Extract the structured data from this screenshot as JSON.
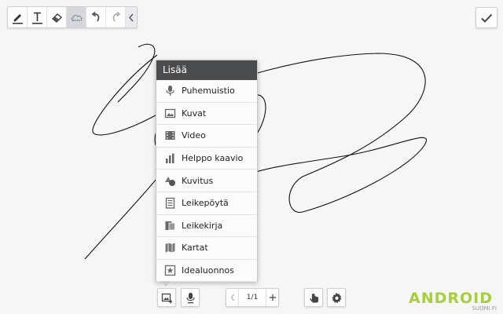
{
  "toolbar": {
    "tools": [
      {
        "icon": "pen-icon",
        "active": false
      },
      {
        "icon": "text-icon",
        "active": false
      },
      {
        "icon": "eraser-icon",
        "active": false
      },
      {
        "icon": "lasso-cloud-icon",
        "active": true
      },
      {
        "icon": "undo-icon",
        "active": false
      },
      {
        "icon": "redo-icon",
        "active": false
      },
      {
        "icon": "collapse-chevron-icon",
        "active": false
      }
    ]
  },
  "done_icon": "checkmark-icon",
  "insert_menu": {
    "title": "Lisää",
    "items": [
      {
        "label": "Puhemuistio",
        "icon": "microphone-icon"
      },
      {
        "label": "Kuvat",
        "icon": "image-icon"
      },
      {
        "label": "Video",
        "icon": "film-icon"
      },
      {
        "label": "Helppo kaavio",
        "icon": "bar-chart-icon"
      },
      {
        "label": "Kuvitus",
        "icon": "shapes-icon"
      },
      {
        "label": "Leikepöytä",
        "icon": "clipboard-icon"
      },
      {
        "label": "Leikekirja",
        "icon": "scrapbook-icon"
      },
      {
        "label": "Kartat",
        "icon": "map-icon"
      },
      {
        "label": "Idealuonnos",
        "icon": "idea-sketch-icon"
      }
    ]
  },
  "bottom_bar": {
    "insert_icon": "insert-media-icon",
    "voice_icon": "microphone-icon",
    "page_indicator": "1/1",
    "prev_icon": "chevron-left-icon",
    "add_page_icon": "plus-icon",
    "hand_mode_icon": "pen-hand-icon",
    "settings_icon": "gear-icon"
  },
  "watermark": {
    "logo": "ANDROID",
    "sub": "SUOMI.FI"
  },
  "colors": {
    "menu_header": "#4a4b4d",
    "stroke": "#111111",
    "watermark_green": "#a6cf3a",
    "active_tool": "#d5d7dc"
  }
}
